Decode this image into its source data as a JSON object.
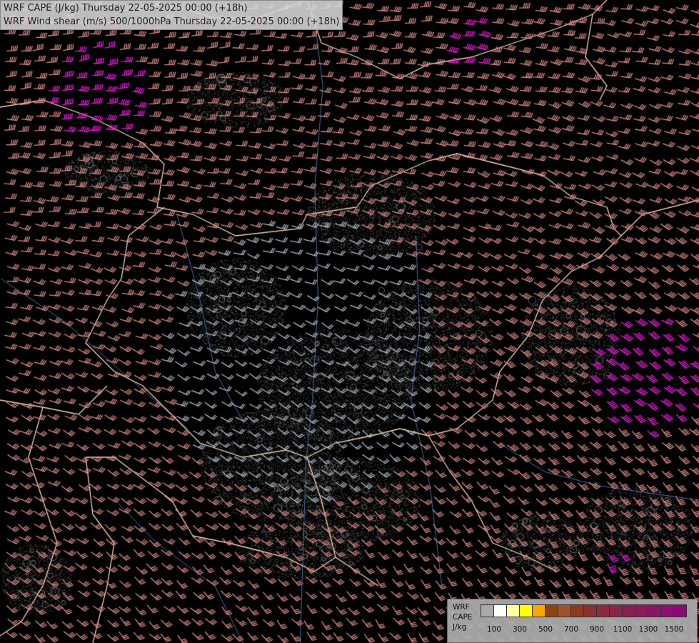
{
  "titles": {
    "cape": "WRF CAPE (J/kg) Thursday 22-05-2025 00:00 (+18h)",
    "shear": "WRF Wind shear (m/s) 500/1000hPa Thursday 22-05-2025 00:00 (+18h)"
  },
  "legend": {
    "model": "WRF",
    "field": "CAPE",
    "unit": "J/kg",
    "ticks": [
      "100",
      "300",
      "500",
      "700",
      "900",
      "1100",
      "1300",
      "1500"
    ],
    "colors": [
      "#a9a9a9",
      "#ffffff",
      "#ffffa0",
      "#ffff00",
      "#ffa500",
      "#8b4513",
      "#a0522d",
      "#8b3a20",
      "#8b3030",
      "#8b2a3a",
      "#8b2545",
      "#8b2050",
      "#8b1a5a",
      "#8b1565",
      "#8b1070",
      "#8b0a7a"
    ]
  },
  "colors": {
    "background": "#000000",
    "border": "#f5d5b0",
    "river": "#4a6ea8",
    "barb_low": "#b0b8c8",
    "barb_mid": "#d98a86",
    "barb_high": "#e81ed8"
  }
}
